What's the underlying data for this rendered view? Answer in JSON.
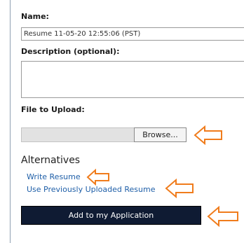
{
  "form": {
    "name_label": "Name:",
    "name_value": "Resume 11-05-20 12:55:06 (PST)",
    "description_label": "Description (optional):",
    "description_value": "",
    "file_label": "File to Upload:",
    "browse_label": "Browse..."
  },
  "alternatives": {
    "heading": "Alternatives",
    "write_resume_link": "Write Resume",
    "previous_resume_link": "Use Previously Uploaded Resume"
  },
  "actions": {
    "add_label": "Add to my Application"
  },
  "colors": {
    "arrow": "#f07c1c",
    "link": "#1f5fa8",
    "primary_button": "#0f1b33"
  },
  "icons": {
    "annotation_arrow": "left-pointing-arrow"
  }
}
